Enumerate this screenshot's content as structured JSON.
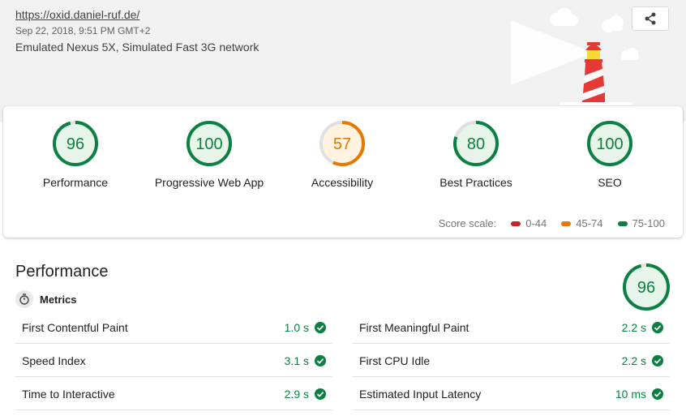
{
  "header": {
    "url": "https://oxid.daniel-ruf.de/",
    "timestamp": "Sep 22, 2018, 9:51 PM GMT+2",
    "environment": "Emulated Nexus 5X, Simulated Fast 3G network",
    "share_icon": "share-icon"
  },
  "colors": {
    "pass": "#0b8043",
    "average": "#e67700",
    "fail": "#c7221f",
    "track": "#e0e0e0"
  },
  "scores": [
    {
      "label": "Performance",
      "score": 96,
      "status": "pass"
    },
    {
      "label": "Progressive Web App",
      "score": 100,
      "status": "pass"
    },
    {
      "label": "Accessibility",
      "score": 57,
      "status": "average"
    },
    {
      "label": "Best Practices",
      "score": 80,
      "status": "pass"
    },
    {
      "label": "SEO",
      "score": 100,
      "status": "pass"
    }
  ],
  "score_scale": {
    "label": "Score scale:",
    "ranges": [
      {
        "label": "0-44",
        "color": "#c7221f"
      },
      {
        "label": "45-74",
        "color": "#e67700"
      },
      {
        "label": "75-100",
        "color": "#0b8043"
      }
    ]
  },
  "performance": {
    "title": "Performance",
    "score": 96,
    "metrics_label": "Metrics",
    "metrics_icon": "stopwatch-icon",
    "metrics": [
      {
        "name": "First Contentful Paint",
        "value": "1.0 s"
      },
      {
        "name": "First Meaningful Paint",
        "value": "2.2 s"
      },
      {
        "name": "Speed Index",
        "value": "3.1 s"
      },
      {
        "name": "First CPU Idle",
        "value": "2.2 s"
      },
      {
        "name": "Time to Interactive",
        "value": "2.9 s"
      },
      {
        "name": "Estimated Input Latency",
        "value": "10 ms"
      }
    ]
  }
}
